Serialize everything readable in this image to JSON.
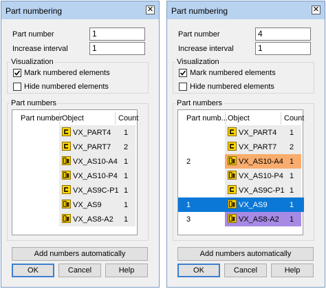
{
  "dialogs": [
    {
      "title": "Part numbering",
      "close": "✕",
      "part_number_label": "Part number",
      "part_number_value": "1",
      "increase_label": "Increase interval",
      "increase_value": "1",
      "visualization_label": "Visualization",
      "mark_label": "Mark numbered elements",
      "mark_checked": true,
      "hide_label": "Hide numbered elements",
      "hide_checked": false,
      "part_numbers_label": "Part numbers",
      "grid": {
        "col_num": "Part number",
        "col_obj": "Object",
        "col_cnt": "Count",
        "rows": [
          {
            "num": "",
            "object": "VX_PART4",
            "count": "1",
            "icon": "part-icon",
            "highlight": null
          },
          {
            "num": "",
            "object": "VX_PART7",
            "count": "2",
            "icon": "part-icon",
            "highlight": null
          },
          {
            "num": "",
            "object": "VX_AS10-A4",
            "count": "1",
            "icon": "assembly-icon",
            "highlight": null
          },
          {
            "num": "",
            "object": "VX_AS10-P4",
            "count": "1",
            "icon": "assembly-icon",
            "highlight": null
          },
          {
            "num": "",
            "object": "VX_AS9C-P1",
            "count": "1",
            "icon": "part-icon",
            "highlight": null
          },
          {
            "num": "",
            "object": "VX_AS9",
            "count": "1",
            "icon": "assembly-icon",
            "highlight": null
          },
          {
            "num": "",
            "object": "VX_AS8-A2",
            "count": "1",
            "icon": "assembly-icon",
            "highlight": null
          }
        ]
      },
      "add_button": "Add numbers automatically",
      "ok": "OK",
      "cancel": "Cancel",
      "help": "Help"
    },
    {
      "title": "Part numbering",
      "close": "✕",
      "part_number_label": "Part number",
      "part_number_value": "4",
      "increase_label": "Increase interval",
      "increase_value": "1",
      "visualization_label": "Visualization",
      "mark_label": "Mark numbered elements",
      "mark_checked": true,
      "hide_label": "Hide numbered elements",
      "hide_checked": false,
      "part_numbers_label": "Part numbers",
      "grid": {
        "col_num": "Part numb...",
        "col_obj": "Object",
        "col_cnt": "Count",
        "rows": [
          {
            "num": "",
            "object": "VX_PART4",
            "count": "1",
            "icon": "part-icon",
            "highlight": null
          },
          {
            "num": "",
            "object": "VX_PART7",
            "count": "2",
            "icon": "part-icon",
            "highlight": null
          },
          {
            "num": "2",
            "object": "VX_AS10-A4",
            "count": "1",
            "icon": "assembly-icon",
            "highlight": "orange"
          },
          {
            "num": "",
            "object": "VX_AS10-P4",
            "count": "1",
            "icon": "assembly-icon",
            "highlight": null
          },
          {
            "num": "",
            "object": "VX_AS9C-P1",
            "count": "1",
            "icon": "part-icon",
            "highlight": null
          },
          {
            "num": "1",
            "object": "VX_AS9",
            "count": "1",
            "icon": "assembly-icon",
            "highlight": "selected"
          },
          {
            "num": "3",
            "object": "VX_AS8-A2",
            "count": "1",
            "icon": "assembly-icon",
            "highlight": "purple"
          }
        ]
      },
      "add_button": "Add numbers automatically",
      "ok": "OK",
      "cancel": "Cancel",
      "help": "Help"
    }
  ],
  "colors": {
    "orange": "#f9ac6e",
    "purple": "#a68ae4",
    "selected": "#0b78d7",
    "icon_yellow": "#ffd700"
  }
}
